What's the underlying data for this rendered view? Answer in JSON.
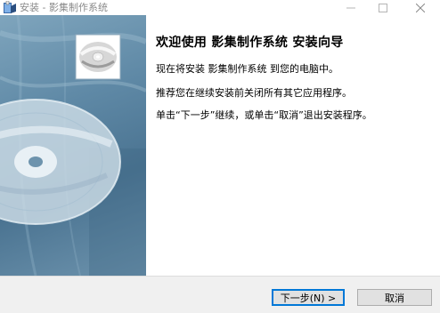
{
  "window": {
    "title": "安装 - 影集制作系统",
    "controls": {
      "minimize": "—",
      "maximize": "☐",
      "close": "✕"
    }
  },
  "icons": {
    "app": "setup-box-icon",
    "banner": "cd-disc-icon"
  },
  "content": {
    "heading": "欢迎使用 影集制作系统 安装向导",
    "paragraphs": [
      "现在将安装 影集制作系统 到您的电脑中。",
      "推荐您在继续安装前关闭所有其它应用程序。",
      "单击“下一步”继续，或单击“取消”退出安装程序。"
    ]
  },
  "buttons": {
    "next": "下一步(N) >",
    "cancel": "取消"
  },
  "colors": {
    "accent": "#0078d7",
    "banner": "#5f89a6"
  }
}
